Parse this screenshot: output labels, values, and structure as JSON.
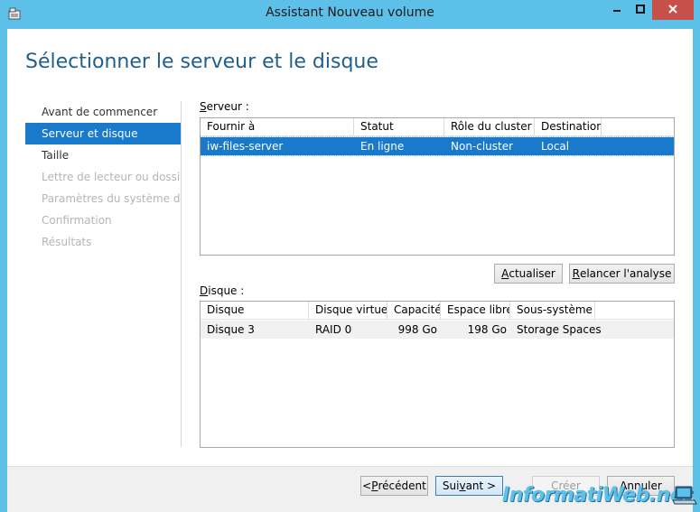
{
  "window": {
    "title": "Assistant Nouveau volume",
    "icon": "wizard-icon",
    "controls": [
      "minimize-icon",
      "maximize-icon",
      "close-icon"
    ]
  },
  "page": {
    "heading": "Sélectionner le serveur et le disque"
  },
  "nav": {
    "items": [
      {
        "label": "Avant de commencer",
        "state": "normal"
      },
      {
        "label": "Serveur et disque",
        "state": "active"
      },
      {
        "label": "Taille",
        "state": "normal"
      },
      {
        "label": "Lettre de lecteur ou dossier",
        "state": "disabled"
      },
      {
        "label": "Paramètres du système d...",
        "state": "disabled"
      },
      {
        "label": "Confirmation",
        "state": "disabled"
      },
      {
        "label": "Résultats",
        "state": "disabled"
      }
    ]
  },
  "server": {
    "label_prefix": "S",
    "label_rest": "erveur :",
    "columns": [
      "Fournir à",
      "Statut",
      "Rôle du cluster",
      "Destination"
    ],
    "rows": [
      {
        "provider": "iw-files-server",
        "status": "En ligne",
        "role": "Non-cluster",
        "destination": "Local"
      }
    ],
    "refresh_prefix": "A",
    "refresh_rest": "ctualiser",
    "rescan_prefix": "R",
    "rescan_rest": "elancer l'analyse"
  },
  "disk": {
    "label_prefix": "D",
    "label_rest": "isque :",
    "columns": [
      "Disque",
      "Disque virtuel",
      "Capacité",
      "Espace libre",
      "Sous-système"
    ],
    "rows": [
      {
        "disk": "Disque 3",
        "virtual_disk": "RAID 0",
        "capacity": "998 Go",
        "free": "198 Go",
        "subsystem": "Storage Spaces"
      }
    ]
  },
  "footer": {
    "previous_pre": "< ",
    "previous_u": "P",
    "previous_rest": "récédent",
    "next_pre": "Sui",
    "next_u": "v",
    "next_rest": "ant >",
    "create_pre": "",
    "create_u": "C",
    "create_rest": "réer",
    "cancel_label": "Annuler"
  },
  "watermark": {
    "text": "InformatiWeb.net"
  },
  "colors": {
    "titlebar": "#5cc0e8",
    "accent": "#1979ca",
    "heading": "#1f5f8f",
    "close": "#c7504a"
  }
}
